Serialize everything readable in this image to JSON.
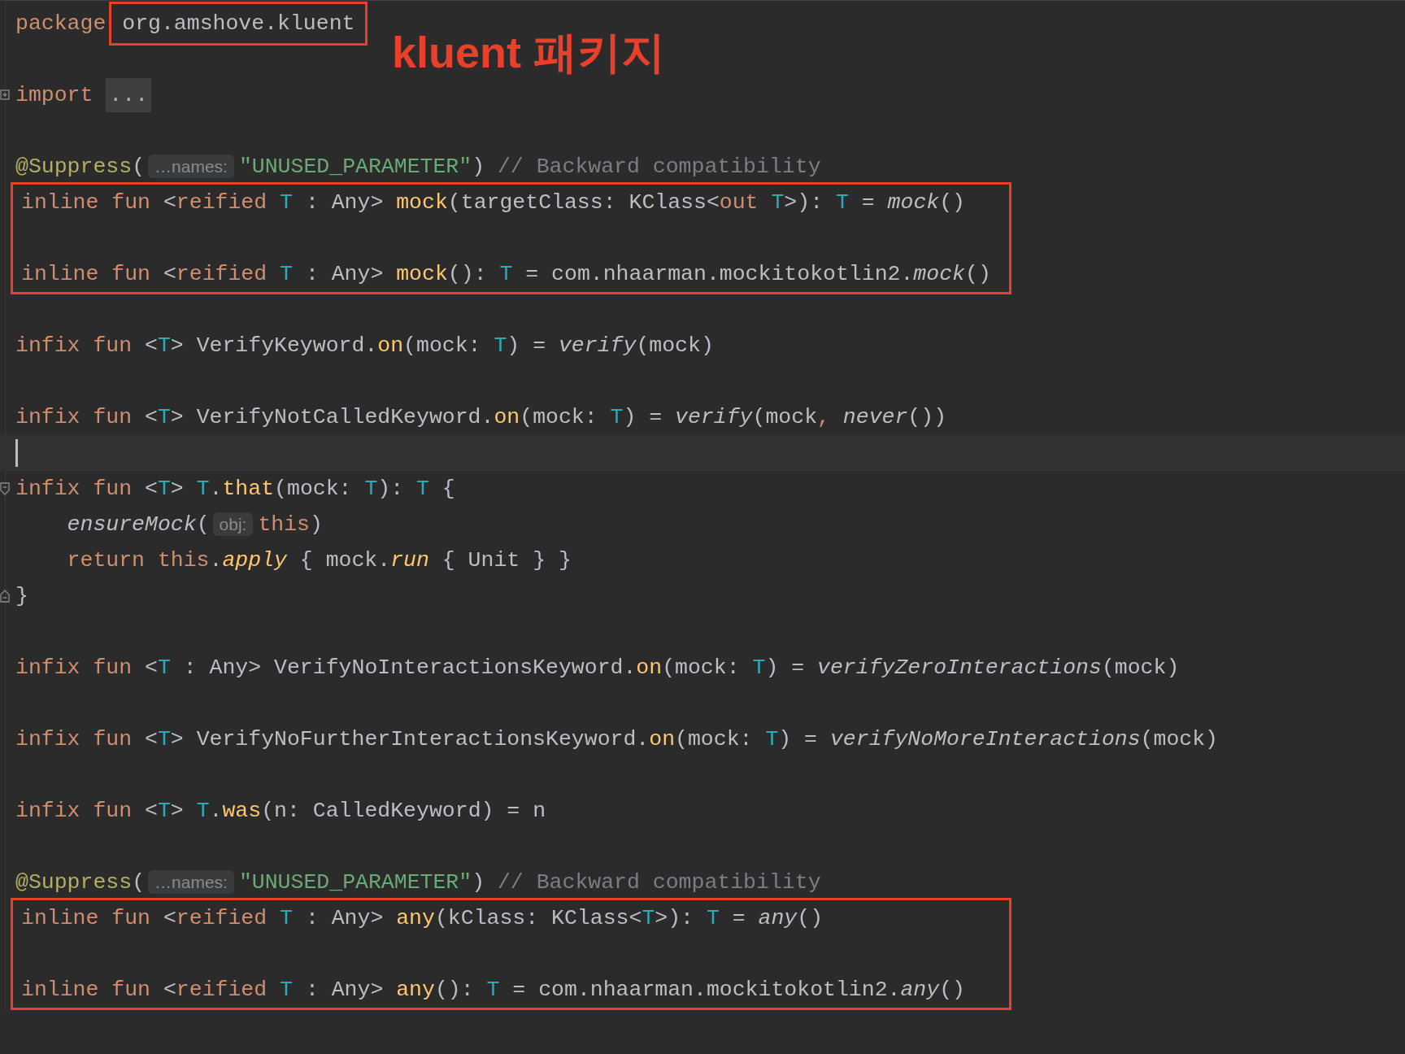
{
  "callout": {
    "text": "kluent 패키지"
  },
  "blocks": [
    {
      "boxed": false,
      "lines": [
        {
          "kind": "code",
          "tokens": [
            {
              "kind": "kw",
              "text": "package "
            },
            {
              "kind": "pkg",
              "text": "org.amshove.kluent"
            }
          ]
        },
        {
          "kind": "blank"
        },
        {
          "kind": "folded",
          "tokens": [
            {
              "kind": "kw",
              "text": "import "
            },
            {
              "kind": "folded",
              "text": "..."
            }
          ]
        },
        {
          "kind": "blank"
        },
        {
          "kind": "code",
          "tokens": [
            {
              "kind": "ann",
              "text": "@Suppress"
            },
            {
              "kind": "txt",
              "text": "("
            },
            {
              "kind": "hint",
              "text": "…names:"
            },
            {
              "kind": "str",
              "text": "\"UNUSED_PARAMETER\""
            },
            {
              "kind": "txt",
              "text": ") "
            },
            {
              "kind": "cmt",
              "text": "// Backward compatibility"
            }
          ]
        }
      ]
    },
    {
      "boxed": true,
      "lines": [
        {
          "kind": "code",
          "tokens": [
            {
              "kind": "kw",
              "text": "inline fun "
            },
            {
              "kind": "txt",
              "text": "<"
            },
            {
              "kind": "kw",
              "text": "reified "
            },
            {
              "kind": "tp",
              "text": "T"
            },
            {
              "kind": "txt",
              "text": " : Any> "
            },
            {
              "kind": "fn",
              "text": "mock"
            },
            {
              "kind": "txt",
              "text": "(targetClass: KClass<"
            },
            {
              "kind": "kw",
              "text": "out "
            },
            {
              "kind": "tp",
              "text": "T"
            },
            {
              "kind": "txt",
              "text": ">): "
            },
            {
              "kind": "tp",
              "text": "T"
            },
            {
              "kind": "txt",
              "text": " = "
            },
            {
              "kind": "it",
              "text": "mock"
            },
            {
              "kind": "txt",
              "text": "()"
            }
          ]
        },
        {
          "kind": "blank"
        },
        {
          "kind": "code",
          "tokens": [
            {
              "kind": "kw",
              "text": "inline fun "
            },
            {
              "kind": "txt",
              "text": "<"
            },
            {
              "kind": "kw",
              "text": "reified "
            },
            {
              "kind": "tp",
              "text": "T"
            },
            {
              "kind": "txt",
              "text": " : Any> "
            },
            {
              "kind": "fn",
              "text": "mock"
            },
            {
              "kind": "txt",
              "text": "(): "
            },
            {
              "kind": "tp",
              "text": "T"
            },
            {
              "kind": "txt",
              "text": " = com.nhaarman.mockitokotlin2."
            },
            {
              "kind": "it",
              "text": "mock"
            },
            {
              "kind": "txt",
              "text": "()"
            }
          ]
        }
      ]
    },
    {
      "boxed": false,
      "lines": [
        {
          "kind": "blank"
        },
        {
          "kind": "code",
          "tokens": [
            {
              "kind": "kw",
              "text": "infix fun "
            },
            {
              "kind": "txt",
              "text": "<"
            },
            {
              "kind": "tp",
              "text": "T"
            },
            {
              "kind": "txt",
              "text": "> VerifyKeyword."
            },
            {
              "kind": "fn",
              "text": "on"
            },
            {
              "kind": "txt",
              "text": "(mock: "
            },
            {
              "kind": "tp",
              "text": "T"
            },
            {
              "kind": "txt",
              "text": ") = "
            },
            {
              "kind": "it",
              "text": "verify"
            },
            {
              "kind": "txt",
              "text": "(mock)"
            }
          ]
        },
        {
          "kind": "blank"
        },
        {
          "kind": "code",
          "tokens": [
            {
              "kind": "kw",
              "text": "infix fun "
            },
            {
              "kind": "txt",
              "text": "<"
            },
            {
              "kind": "tp",
              "text": "T"
            },
            {
              "kind": "txt",
              "text": "> VerifyNotCalledKeyword."
            },
            {
              "kind": "fn",
              "text": "on"
            },
            {
              "kind": "txt",
              "text": "(mock: "
            },
            {
              "kind": "tp",
              "text": "T"
            },
            {
              "kind": "txt",
              "text": ") = "
            },
            {
              "kind": "it",
              "text": "verify"
            },
            {
              "kind": "txt",
              "text": "(mock"
            },
            {
              "kind": "kw",
              "text": ", "
            },
            {
              "kind": "it",
              "text": "never"
            },
            {
              "kind": "txt",
              "text": "())"
            }
          ]
        },
        {
          "kind": "caret"
        },
        {
          "kind": "fold_start",
          "tokens": [
            {
              "kind": "kw",
              "text": "infix fun "
            },
            {
              "kind": "txt",
              "text": "<"
            },
            {
              "kind": "tp",
              "text": "T"
            },
            {
              "kind": "txt",
              "text": "> "
            },
            {
              "kind": "tp",
              "text": "T"
            },
            {
              "kind": "txt",
              "text": "."
            },
            {
              "kind": "fn",
              "text": "that"
            },
            {
              "kind": "txt",
              "text": "(mock: "
            },
            {
              "kind": "tp",
              "text": "T"
            },
            {
              "kind": "txt",
              "text": "): "
            },
            {
              "kind": "tp",
              "text": "T"
            },
            {
              "kind": "txt",
              "text": " {"
            }
          ],
          "children": [
            {
              "kind": "code",
              "tokens": [
                {
                  "kind": "it",
                  "text": "ensureMock"
                },
                {
                  "kind": "txt",
                  "text": "("
                },
                {
                  "kind": "hint",
                  "text": "obj:"
                },
                {
                  "kind": "kw",
                  "text": "this"
                },
                {
                  "kind": "txt",
                  "text": ")"
                }
              ]
            },
            {
              "kind": "code",
              "tokens": [
                {
                  "kind": "kw",
                  "text": "return this"
                },
                {
                  "kind": "txt",
                  "text": "."
                },
                {
                  "kind": "itfn",
                  "text": "apply"
                },
                {
                  "kind": "txt",
                  "text": " { mock."
                },
                {
                  "kind": "itfn",
                  "text": "run"
                },
                {
                  "kind": "txt",
                  "text": " { Unit } }"
                }
              ]
            }
          ]
        },
        {
          "kind": "fold_end",
          "tokens": [
            {
              "kind": "txt",
              "text": "}"
            }
          ]
        },
        {
          "kind": "blank"
        },
        {
          "kind": "code",
          "tokens": [
            {
              "kind": "kw",
              "text": "infix fun "
            },
            {
              "kind": "txt",
              "text": "<"
            },
            {
              "kind": "tp",
              "text": "T"
            },
            {
              "kind": "txt",
              "text": " : Any> VerifyNoInteractionsKeyword."
            },
            {
              "kind": "fn",
              "text": "on"
            },
            {
              "kind": "txt",
              "text": "(mock: "
            },
            {
              "kind": "tp",
              "text": "T"
            },
            {
              "kind": "txt",
              "text": ") = "
            },
            {
              "kind": "it",
              "text": "verifyZeroInteractions"
            },
            {
              "kind": "txt",
              "text": "(mock)"
            }
          ]
        },
        {
          "kind": "blank"
        },
        {
          "kind": "code",
          "tokens": [
            {
              "kind": "kw",
              "text": "infix fun "
            },
            {
              "kind": "txt",
              "text": "<"
            },
            {
              "kind": "tp",
              "text": "T"
            },
            {
              "kind": "txt",
              "text": "> VerifyNoFurtherInteractionsKeyword."
            },
            {
              "kind": "fn",
              "text": "on"
            },
            {
              "kind": "txt",
              "text": "(mock: "
            },
            {
              "kind": "tp",
              "text": "T"
            },
            {
              "kind": "txt",
              "text": ") = "
            },
            {
              "kind": "it",
              "text": "verifyNoMoreInteractions"
            },
            {
              "kind": "txt",
              "text": "(mock)"
            }
          ]
        },
        {
          "kind": "blank"
        },
        {
          "kind": "code",
          "tokens": [
            {
              "kind": "kw",
              "text": "infix fun "
            },
            {
              "kind": "txt",
              "text": "<"
            },
            {
              "kind": "tp",
              "text": "T"
            },
            {
              "kind": "txt",
              "text": "> "
            },
            {
              "kind": "tp",
              "text": "T"
            },
            {
              "kind": "txt",
              "text": "."
            },
            {
              "kind": "fn",
              "text": "was"
            },
            {
              "kind": "txt",
              "text": "(n: CalledKeyword) = n"
            }
          ]
        },
        {
          "kind": "blank"
        },
        {
          "kind": "code",
          "tokens": [
            {
              "kind": "ann",
              "text": "@Suppress"
            },
            {
              "kind": "txt",
              "text": "("
            },
            {
              "kind": "hint",
              "text": "…names:"
            },
            {
              "kind": "str",
              "text": "\"UNUSED_PARAMETER\""
            },
            {
              "kind": "txt",
              "text": ") "
            },
            {
              "kind": "cmt",
              "text": "// Backward compatibility"
            }
          ]
        }
      ]
    },
    {
      "boxed": true,
      "lines": [
        {
          "kind": "code",
          "tokens": [
            {
              "kind": "kw",
              "text": "inline fun "
            },
            {
              "kind": "txt",
              "text": "<"
            },
            {
              "kind": "kw",
              "text": "reified "
            },
            {
              "kind": "tp",
              "text": "T"
            },
            {
              "kind": "txt",
              "text": " : Any> "
            },
            {
              "kind": "fn",
              "text": "any"
            },
            {
              "kind": "txt",
              "text": "(kClass: KClass<"
            },
            {
              "kind": "tp",
              "text": "T"
            },
            {
              "kind": "txt",
              "text": ">): "
            },
            {
              "kind": "tp",
              "text": "T"
            },
            {
              "kind": "txt",
              "text": " = "
            },
            {
              "kind": "it",
              "text": "any"
            },
            {
              "kind": "txt",
              "text": "()"
            }
          ]
        },
        {
          "kind": "blank"
        },
        {
          "kind": "code",
          "tokens": [
            {
              "kind": "kw",
              "text": "inline fun "
            },
            {
              "kind": "txt",
              "text": "<"
            },
            {
              "kind": "kw",
              "text": "reified "
            },
            {
              "kind": "tp",
              "text": "T"
            },
            {
              "kind": "txt",
              "text": " : Any> "
            },
            {
              "kind": "fn",
              "text": "any"
            },
            {
              "kind": "txt",
              "text": "(): "
            },
            {
              "kind": "tp",
              "text": "T"
            },
            {
              "kind": "txt",
              "text": " = com.nhaarman.mockitokotlin2."
            },
            {
              "kind": "it",
              "text": "any"
            },
            {
              "kind": "txt",
              "text": "()"
            }
          ]
        }
      ]
    }
  ]
}
